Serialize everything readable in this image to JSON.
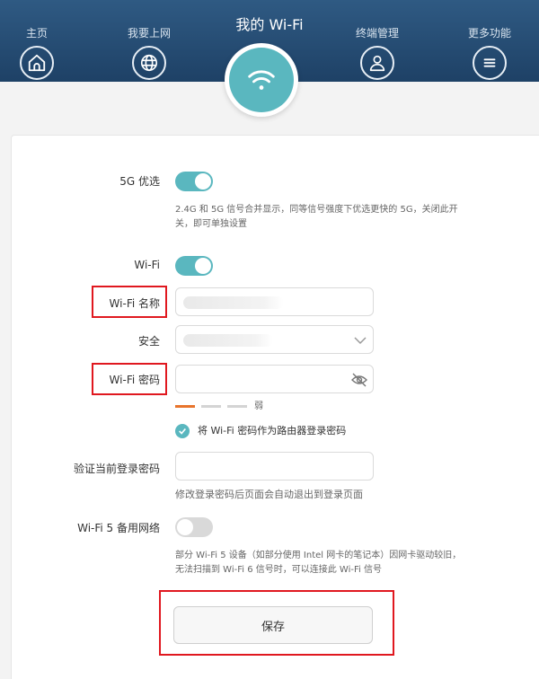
{
  "header": {
    "title": "我的 Wi-Fi",
    "nav": [
      {
        "label": "主页",
        "icon": "home-icon"
      },
      {
        "label": "我要上网",
        "icon": "globe-icon"
      },
      {
        "label": "终端管理",
        "icon": "user-icon"
      },
      {
        "label": "更多功能",
        "icon": "menu-icon"
      }
    ],
    "active_icon": "wifi-icon"
  },
  "form": {
    "band_steering": {
      "label": "5G 优选",
      "enabled": true,
      "hint_line1": "2.4G 和 5G 信号合并显示，同等信号强度下优选更快的 5G，关闭此开",
      "hint_line2": "关，即可单独设置"
    },
    "wifi": {
      "label": "Wi-Fi",
      "enabled": true
    },
    "wifi_name": {
      "label": "Wi-Fi 名称",
      "value": ""
    },
    "security": {
      "label": "安全",
      "value": ""
    },
    "wifi_password": {
      "label": "Wi-Fi 密码",
      "value": ""
    },
    "strength": {
      "text": "弱"
    },
    "use_as_login": {
      "label": "将 Wi-Fi 密码作为路由器登录密码",
      "checked": true
    },
    "verify_login": {
      "label": "验证当前登录密码",
      "value": "",
      "hint": "修改登录密码后页面会自动退出到登录页面"
    },
    "wifi5_backup": {
      "label": "Wi-Fi 5 备用网络",
      "enabled": false,
      "hint_line1": "部分 Wi-Fi 5 设备（如部分使用 Intel 网卡的笔记本）因网卡驱动较旧，",
      "hint_line2": "无法扫描到 Wi-Fi 6 信号时，可以连接此 Wi-Fi 信号"
    },
    "save_label": "保存"
  },
  "colors": {
    "header": "#2f5a83",
    "accent": "#5ab7bf",
    "highlight": "#e0181f",
    "strength_weak": "#e8742c"
  }
}
